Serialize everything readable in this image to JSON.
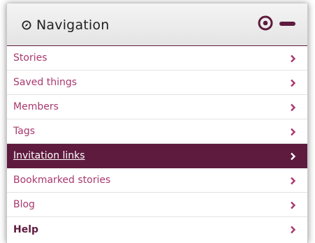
{
  "header": {
    "title": "Navigation",
    "icons": [
      "compass-icon",
      "target-icon",
      "minus-icon"
    ]
  },
  "colors": {
    "brand": "#5e1b3e",
    "link": "#a8386e",
    "header_bg": "#e8e8e8"
  },
  "nav": {
    "items": [
      {
        "label": "Stories"
      },
      {
        "label": "Saved things"
      },
      {
        "label": "Members"
      },
      {
        "label": "Tags"
      },
      {
        "label": "Invitation links"
      },
      {
        "label": "Bookmarked stories"
      },
      {
        "label": "Blog"
      },
      {
        "label": "Help"
      }
    ]
  }
}
